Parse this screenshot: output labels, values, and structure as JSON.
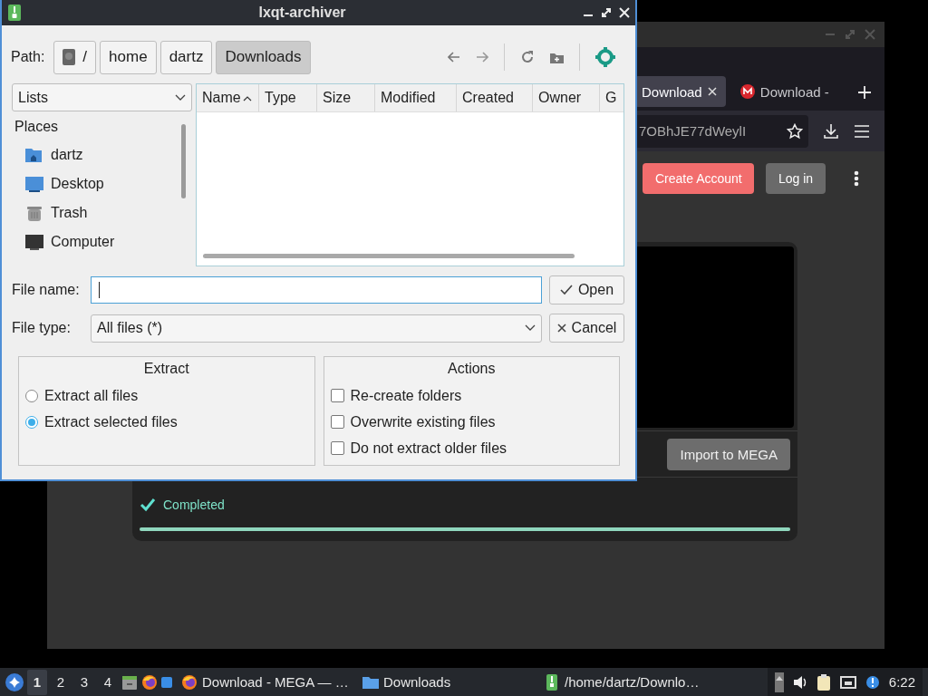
{
  "browser": {
    "tabs": [
      {
        "label": "Download",
        "selected": true
      },
      {
        "label": "Download -",
        "selected": false
      }
    ],
    "url": "7OBhJE77dWeylI",
    "account_buttons": [
      {
        "label": "Create Account",
        "kind": "primary"
      },
      {
        "label": "Log in",
        "kind": "secondary"
      }
    ],
    "import_button": "Import to MEGA",
    "status": "Completed",
    "progress": {
      "level": 1
    }
  },
  "dialog": {
    "title": "lxqt-archiver",
    "path_label": "Path:",
    "path_buttons": [
      {
        "label": "/",
        "kind": "root",
        "selected": false
      },
      {
        "label": "home",
        "kind": "dir",
        "selected": false
      },
      {
        "label": "dartz",
        "kind": "dir",
        "selected": false
      },
      {
        "label": "Downloads",
        "kind": "dir",
        "selected": true
      }
    ],
    "view_combo": "Lists",
    "places_header": "Places",
    "places": [
      {
        "label": "dartz",
        "kind": "home"
      },
      {
        "label": "Desktop",
        "kind": "desktop"
      },
      {
        "label": "Trash",
        "kind": "trash"
      },
      {
        "label": "Computer",
        "kind": "computer"
      }
    ],
    "columns": [
      {
        "label": "Name",
        "sorted": true
      },
      {
        "label": "Type",
        "sorted": false
      },
      {
        "label": "Size",
        "sorted": false
      },
      {
        "label": "Modified",
        "sorted": false
      },
      {
        "label": "Created",
        "sorted": false
      },
      {
        "label": "Owner",
        "sorted": false
      },
      {
        "label": "G",
        "sorted": false
      }
    ],
    "file_name_label": "File name:",
    "open_button": "Open",
    "file_type_label": "File type:",
    "file_type": "All files (*)",
    "cancel_button": "Cancel",
    "extract": {
      "title": "Extract",
      "options": [
        {
          "label": "Extract all files",
          "selected": false
        },
        {
          "label": "Extract selected files",
          "selected": true
        }
      ]
    },
    "actions": {
      "title": "Actions",
      "options": [
        {
          "label": "Re-create folders",
          "checked": false
        },
        {
          "label": "Overwrite existing files",
          "checked": false
        },
        {
          "label": "Do not extract older files",
          "checked": false
        }
      ]
    }
  },
  "taskbar": {
    "desktops": [
      {
        "label": "1",
        "selected": true
      },
      {
        "label": "2",
        "selected": false
      },
      {
        "label": "3",
        "selected": false
      },
      {
        "label": "4",
        "selected": false
      }
    ],
    "tasks": [
      {
        "label": "Download - MEGA — …",
        "kind": "firefox"
      },
      {
        "label": "Downloads",
        "kind": "folder"
      },
      {
        "label": "/home/dartz/Downlo…",
        "kind": "archiver"
      }
    ],
    "clock": "6:22"
  }
}
